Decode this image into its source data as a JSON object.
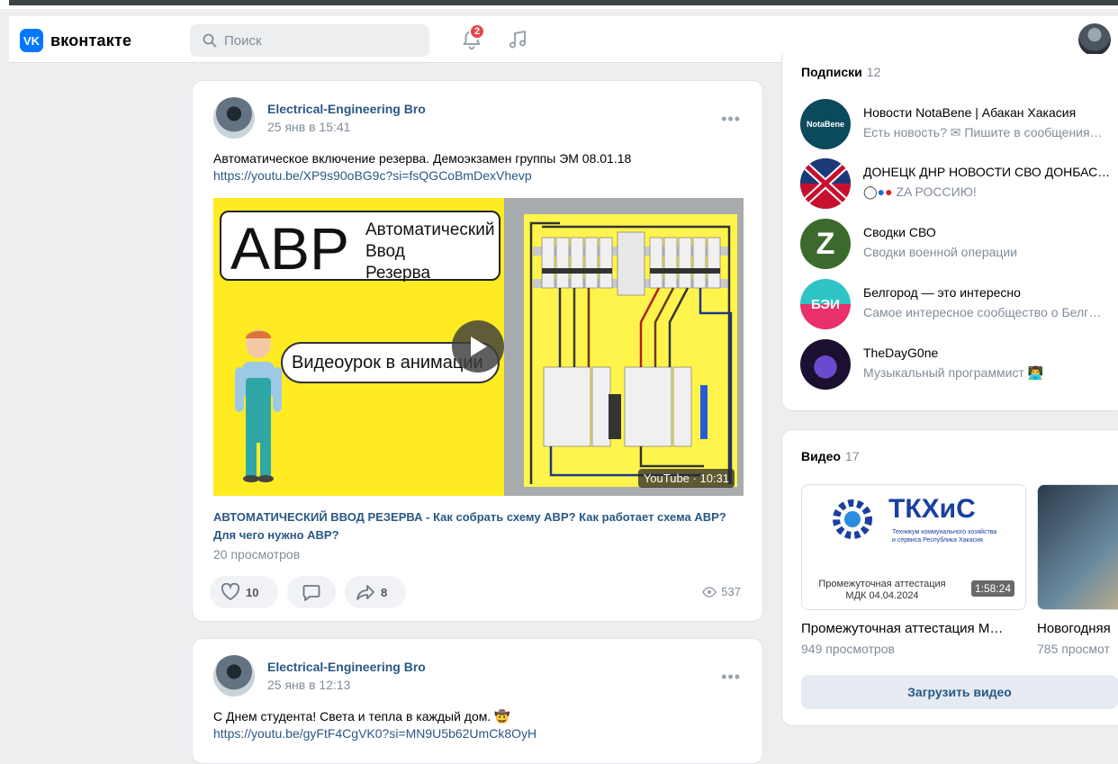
{
  "header": {
    "logo": "вконтакте",
    "logo_mark": "VK",
    "search_placeholder": "Поиск",
    "notifications_count": "2"
  },
  "posts": [
    {
      "author": "Electrical-Engineering Bro",
      "date": "25 янв в 15:41",
      "text": "Автоматическое включение резерва. Демоэкзамен группы ЭМ 08.01.18",
      "link": "https://youtu.be/XP9s90oBG9c?si=fsQGCoBmDexVhevp",
      "video": {
        "big": "АВР",
        "caption_lines": [
          "Автоматический",
          "Ввод",
          "Резерва"
        ],
        "lesson": "Видеоурок в анимации",
        "badge": "YouTube · 10:31"
      },
      "video_title": "АВТОМАТИЧЕСКИЙ ВВОД РЕЗЕРВА - Как собрать схему АВР? Как работает схема АВР? Для чего нужно АВР?",
      "video_views": "20 просмотров",
      "likes": "10",
      "shares": "8",
      "views": "537"
    },
    {
      "author": "Electrical-Engineering Bro",
      "date": "25 янв в 12:13",
      "text": "С Днем студента! Света и тепла в каждый дом. 🤠",
      "link": "https://youtu.be/gyFtF4CgVK0?si=MN9U5b62UmCk8OyH"
    }
  ],
  "subscriptions": {
    "title": "Подписки",
    "count": "12",
    "items": [
      {
        "name": "Новости NotaBene | Абакан Хакасия",
        "desc": "Есть новость? ✉ Пишите в сообщения…",
        "avatar_text": "NotaBene",
        "color": "#0a4a5c"
      },
      {
        "name": "ДОНЕЦК ДНР НОВОСТИ СВО ДОНБАС…",
        "desc": "ZA РОССИЮ!",
        "color": "#1b3a7a"
      },
      {
        "name": "Сводки СВО",
        "desc": "Сводки военной операции",
        "avatar_text": "Z",
        "color": "#3c6a2c"
      },
      {
        "name": "Белгород — это интересно",
        "desc": "Самое интересное сообщество о Белг…",
        "avatar_text": "БЭИ",
        "color": "#2ec4c4"
      },
      {
        "name": "TheDayG0ne",
        "desc": "Музыкальный программист 👨‍💻",
        "color": "#1c1030"
      }
    ]
  },
  "videos": {
    "title": "Видео",
    "count": "17",
    "items": [
      {
        "title": "Промежуточная аттестация М…",
        "views": "949 просмотров",
        "duration": "1:58:24",
        "thumb_brand": "ТКХиС",
        "thumb_sub": "Техникум коммунального хозяйства и сервиса Республика Хакасия",
        "thumb_caption": "Промежуточная аттестация МДК 04.04.2024"
      },
      {
        "title": "Новогодняя",
        "views": "785 просмот"
      }
    ],
    "upload_label": "Загрузить видео"
  }
}
